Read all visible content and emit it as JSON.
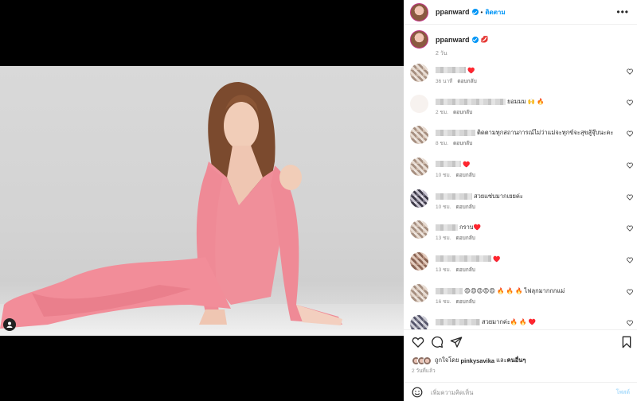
{
  "post": {
    "username": "ppanward",
    "follow_label": "ติดตาม",
    "dot": "•",
    "more": "•••",
    "caption_emoji": "💋",
    "caption_time": "2 วัน"
  },
  "comments": [
    {
      "text": "♥️",
      "time": "36 นาที",
      "reply": "ตอบกลับ"
    },
    {
      "text": "ยอมมม 🙌 🔥",
      "time": "2 ชม.",
      "reply": "ตอบกลับ"
    },
    {
      "text": "ติดตามทุกสถานการณ์ไม่ว่าแม่จะทุกข์จะสุขสู้จุ๊บนะคะ",
      "time": "8 ชม.",
      "reply": "ตอบกลับ"
    },
    {
      "text": "♥️",
      "time": "10 ชม.",
      "reply": "ตอบกลับ"
    },
    {
      "text": "สวยแซ่บมากเยยค่ะ",
      "time": "10 ชม.",
      "reply": "ตอบกลับ"
    },
    {
      "text": "กราบ♥️",
      "time": "13 ชม.",
      "reply": "ตอบกลับ"
    },
    {
      "text": "♥️",
      "time": "13 ชม.",
      "reply": "ตอบกลับ"
    },
    {
      "text": "😍😍😍😍😍 🔥 🔥 🔥 ไฟลุกมากกกแม่",
      "time": "16 ชม.",
      "reply": "ตอบกลับ"
    },
    {
      "text": "สวยมากค่ะ🔥 🔥 ♥️",
      "time": "",
      "reply": ""
    }
  ],
  "likes": {
    "prefix": "ถูกใจโดย",
    "user": "pinkysavika",
    "and": "และ",
    "others": "คนอื่นๆ"
  },
  "post_date": "2 วันที่แล้ว",
  "add_comment": {
    "placeholder": "เพิ่มความคิดเห็น",
    "post_label": "โพสต์"
  },
  "colors": {
    "accent": "#0095f6",
    "heart": "#ed4956",
    "dress": "#f08f9a"
  },
  "icons": [
    "person-tag-icon",
    "heart-icon",
    "comment-icon",
    "share-icon",
    "bookmark-icon",
    "emoji-icon",
    "verified-icon",
    "more-options-icon"
  ]
}
